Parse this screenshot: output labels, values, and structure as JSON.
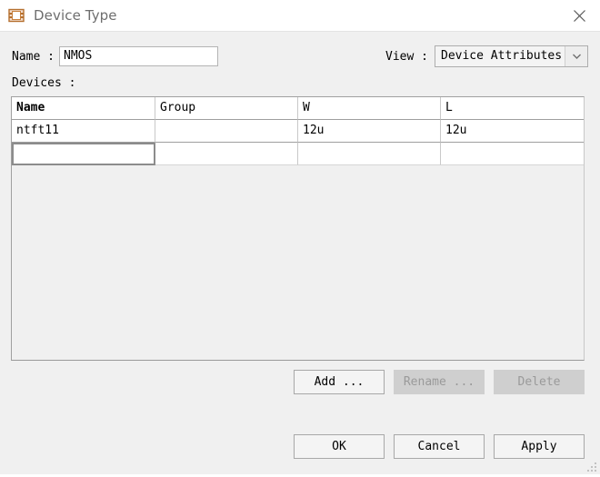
{
  "window": {
    "title": "Device Type",
    "icon": "device-type-icon",
    "close_icon": "close-icon"
  },
  "form": {
    "name_label": "Name :",
    "name_value": "NMOS",
    "name_placeholder": "",
    "view_label": "View :",
    "view_value": "Device Attributes",
    "view_options": [
      "Device Attributes"
    ],
    "view_arrow_icon": "chevron-down-icon"
  },
  "devices": {
    "label": "Devices :",
    "columns": [
      "Name",
      "Group",
      "W",
      "L"
    ],
    "rows": [
      {
        "name": "ntft11",
        "group": "",
        "w": "12u",
        "l": "12u"
      },
      {
        "name": "",
        "group": "",
        "w": "",
        "l": ""
      }
    ]
  },
  "row_buttons": {
    "add": "Add ...",
    "rename": "Rename ...",
    "delete": "Delete"
  },
  "dialog_buttons": {
    "ok": "OK",
    "cancel": "Cancel",
    "apply": "Apply"
  },
  "colors": {
    "dialog_bg": "#f0f0f0",
    "titlebar_bg": "#ffffff",
    "title_text": "#6e6e6e",
    "field_bg": "#ffffff",
    "disabled_bg": "#cfcfcf",
    "disabled_text": "#9a9a9a",
    "icon_accent": "#c8803c"
  }
}
